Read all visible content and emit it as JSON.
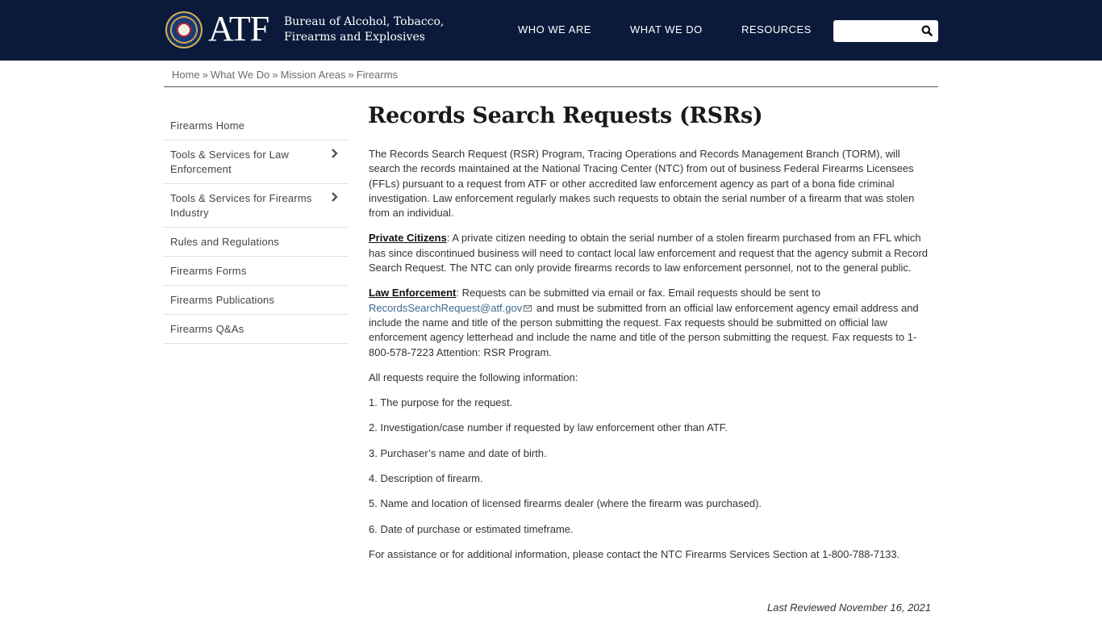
{
  "header": {
    "logo_text": "ATF",
    "agency_line1": "Bureau of Alcohol, Tobacco,",
    "agency_line2": "Firearms and Explosives",
    "background_color": "#0b1a3a",
    "nav": [
      {
        "label": "WHO WE ARE"
      },
      {
        "label": "WHAT WE DO"
      },
      {
        "label": "RESOURCES"
      }
    ],
    "search": {
      "placeholder": "",
      "value": "",
      "icon": "search-icon"
    }
  },
  "breadcrumb": [
    {
      "label": "Home"
    },
    {
      "label": "What We Do"
    },
    {
      "label": "Mission Areas"
    },
    {
      "label": "Firearms"
    }
  ],
  "breadcrumb_separator": "»",
  "sidebar": {
    "items": [
      {
        "label": "Firearms Home",
        "has_children": false
      },
      {
        "label": "Tools & Services for Law Enforcement",
        "has_children": true
      },
      {
        "label": "Tools & Services for Firearms Industry",
        "has_children": true
      },
      {
        "label": "Rules and Regulations",
        "has_children": false
      },
      {
        "label": "Firearms Forms",
        "has_children": false
      },
      {
        "label": "Firearms Publications",
        "has_children": false
      },
      {
        "label": "Firearms Q&As",
        "has_children": false
      }
    ]
  },
  "main": {
    "title": "Records Search Requests (RSRs)",
    "intro": "The Records Search Request (RSR) Program, Tracing Operations and Records Management Branch (TORM), will search the records maintained at the National Tracing Center (NTC) from out of business Federal Firearms Licensees (FFLs) pursuant to a request from ATF or other accredited law enforcement agency as part of a bona fide criminal investigation. Law enforcement regularly makes such requests to obtain the serial number of a firearm that was stolen from an individual.",
    "private_citizens": {
      "heading": "Private Citizens",
      "text": ": A private citizen needing to obtain the serial number of a stolen firearm purchased from an FFL which has since discontinued business will need to contact local law enforcement and request that the agency submit a Record Search Request. The NTC can only provide firearms records to law enforcement personnel, not to the general public."
    },
    "law_enforcement": {
      "heading": "Law Enforcement",
      "text_before": ": Requests can be submitted via email or fax. Email requests should be sent to ",
      "email": "RecordsSearchRequest@atf.gov",
      "email_color": "#3d6a8f",
      "text_after": " and must be submitted from an official law enforcement agency email address and include the name and title of the person submitting the request. Fax requests should be submitted on official law enforcement agency letterhead and include the name and title of the person submitting the request. Fax requests to 1-800-578-7223 Attention: RSR Program."
    },
    "requirements_intro": "All requests require the following information:",
    "requirements": [
      "1. The purpose for the request.",
      "2. Investigation/case number if requested by law enforcement other than ATF.",
      "3. Purchaser’s name and date of birth.",
      "4. Description of firearm.",
      "5. Name and location of licensed firearms dealer (where the firearm was purchased).",
      "6. Date of purchase or estimated timeframe."
    ],
    "assistance": "For assistance or for additional information, please contact the NTC Firearms Services Section at 1-800-788-7133.",
    "last_reviewed": "Last Reviewed November 16, 2021"
  }
}
